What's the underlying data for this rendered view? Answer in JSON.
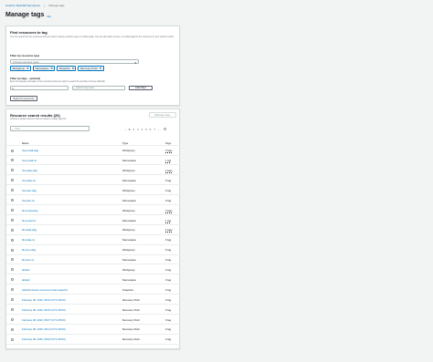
{
  "breadcrumb": {
    "root": "Amazon Redshift Serverless",
    "current": "Manage tags"
  },
  "page": {
    "title": "Manage tags",
    "info": "Info"
  },
  "find": {
    "title": "Find resources to tag",
    "description": "You can search for the resources that you want to tag by resource type or existing tags. You can also add, remove, or modify tags for the resources in your search results.",
    "filter_type_label": "Filter by resource type",
    "filter_type_placeholder": "Choose resource types",
    "chips": [
      "Workgroup",
      "Namespace",
      "Snapshot",
      "Recovery Point"
    ],
    "filter_tags_label": "Filter by tags - optional",
    "filter_tags_desc": "Enter the tag key and value of the resources that you want to search for and then choose Add filter.",
    "tag_key_placeholder": "Q",
    "tag_value_placeholder": "Optional tag value",
    "add_filter": "Add filter",
    "search_button": "Search resources"
  },
  "results": {
    "title": "Resource search results (20)",
    "description": "Choose a single resource that you want to modify tags for.",
    "manage_button": "Manage tags",
    "search_placeholder": "Find",
    "pages": [
      "1",
      "2",
      "3",
      "4",
      "5",
      "6",
      "7"
    ],
    "columns": {
      "name": "Name",
      "type": "Type",
      "tags": "Tags"
    },
    "rows": [
      {
        "name": "rise-pmail-wkg",
        "type": "Workgroup",
        "tags": "3 tags"
      },
      {
        "name": "rise-pmail-ns",
        "type": "Namespace",
        "tags": "1 tag"
      },
      {
        "name": "rise-data-wkg",
        "type": "Workgroup",
        "tags": "2 tags"
      },
      {
        "name": "rise-data-ns",
        "type": "Namespace",
        "tags": "0 tag"
      },
      {
        "name": "rise-dev-wkg",
        "type": "Workgroup",
        "tags": "0 tag"
      },
      {
        "name": "rise-dev-ns",
        "type": "Namespace",
        "tags": "0 tag"
      },
      {
        "name": "fkn-pmail-wkg",
        "type": "Workgroup",
        "tags": "3 tags"
      },
      {
        "name": "fkn-pmail-ns",
        "type": "Namespace",
        "tags": "1 tag"
      },
      {
        "name": "fkn-data-wkg",
        "type": "Workgroup",
        "tags": "2 tags"
      },
      {
        "name": "fkn-data-ns",
        "type": "Namespace",
        "tags": "0 tag"
      },
      {
        "name": "fkn-dev-wkg",
        "type": "Workgroup",
        "tags": "0 tag"
      },
      {
        "name": "fkn-dev-ns",
        "type": "Namespace",
        "tags": "0 tag"
      },
      {
        "name": "default",
        "type": "Workgroup",
        "tags": "0 tag"
      },
      {
        "name": "default",
        "type": "Namespace",
        "tags": "0 tag"
      },
      {
        "name": "redshift-cluster-consumer-final-snapshot",
        "type": "Snapshot",
        "tags": "0 tag"
      },
      {
        "name": "February 28, 2022, 08:43 (UTC-05:00)",
        "type": "Recovery Point",
        "tags": "0 tag"
      },
      {
        "name": "February 28, 2022, 08:33 (UTC-05:00)",
        "type": "Recovery Point",
        "tags": "0 tag"
      },
      {
        "name": "February 28, 2022, 08:27 (UTC-05:00)",
        "type": "Recovery Point",
        "tags": "0 tag"
      },
      {
        "name": "February 28, 2022, 08:13 (UTC-05:00)",
        "type": "Recovery Point",
        "tags": "0 tag"
      },
      {
        "name": "February 28, 2022, 08:03 (UTC-05:00)",
        "type": "Recovery Point",
        "tags": "0 tag"
      }
    ]
  }
}
